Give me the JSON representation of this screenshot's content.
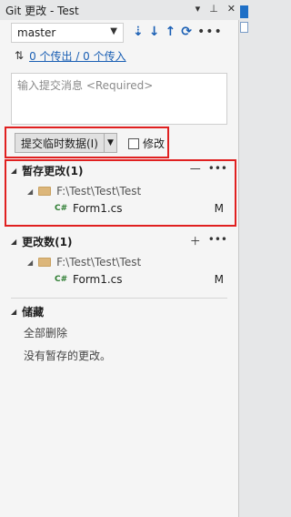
{
  "window": {
    "title": "Git 更改 - Test",
    "pin_icon": "pin-icon",
    "close_icon": "close-icon"
  },
  "branch": {
    "name": "master",
    "actions": [
      "fetch-icon",
      "pull-icon",
      "push-icon",
      "sync-icon",
      "more-icon"
    ]
  },
  "sync": {
    "text": "0 个传出 / 0 个传入"
  },
  "commit": {
    "placeholder": "输入提交消息 <Required>",
    "button_label": "提交临时数据(I)",
    "amend_label": "修改"
  },
  "staged": {
    "header": "暂存更改(1)",
    "folder": "F:\\Test\\Test\\Test",
    "file": "Form1.cs",
    "file_icon": "C#",
    "status": "M"
  },
  "changes": {
    "header": "更改数(1)",
    "folder": "F:\\Test\\Test\\Test",
    "file": "Form1.cs",
    "file_icon": "C#",
    "status": "M"
  },
  "stash": {
    "header": "储藏",
    "clear_all": "全部删除",
    "empty_text": "没有暂存的更改。"
  }
}
